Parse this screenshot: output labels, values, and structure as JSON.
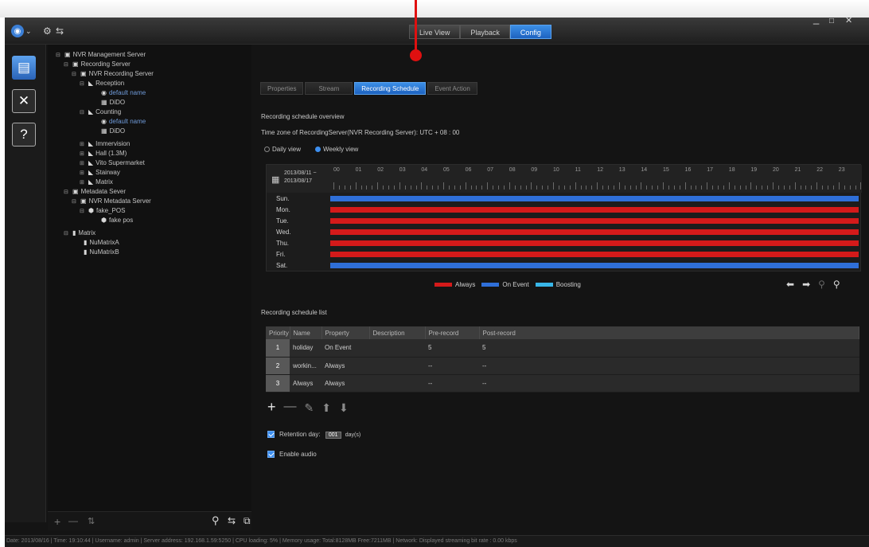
{
  "titlebar": {
    "nav_tabs": [
      {
        "label": "Live View",
        "active": false
      },
      {
        "label": "Playback",
        "active": false
      },
      {
        "label": "Config",
        "active": true
      }
    ],
    "window_controls": [
      "_",
      "□",
      "✕"
    ]
  },
  "tree": {
    "nodes": [
      {
        "label": "NVR Management Server",
        "toggle": "⊟",
        "icon": "server-icon"
      },
      {
        "label": "Recording Server",
        "toggle": "⊟",
        "icon": "server-icon"
      },
      {
        "label": "NVR Recording Server",
        "toggle": "⊟",
        "icon": "server-icon"
      },
      {
        "label": "Reception",
        "toggle": "⊟",
        "icon": "camera-group-icon"
      },
      {
        "label": "default name",
        "toggle": "",
        "icon": "camera-icon"
      },
      {
        "label": "DiDO",
        "toggle": "",
        "icon": "dido-icon"
      },
      {
        "label": "Counting",
        "toggle": "⊟",
        "icon": "camera-group-icon"
      },
      {
        "label": "default name",
        "toggle": "",
        "icon": "camera-icon"
      },
      {
        "label": "DiDO",
        "toggle": "",
        "icon": "dido-icon"
      },
      {
        "label": "Immervision",
        "toggle": "⊞",
        "icon": "camera-group-icon"
      },
      {
        "label": "Hall (1.3M)",
        "toggle": "⊞",
        "icon": "camera-group-icon"
      },
      {
        "label": "Vito Supermarket",
        "toggle": "⊞",
        "icon": "camera-group-icon"
      },
      {
        "label": "Stairway",
        "toggle": "⊞",
        "icon": "camera-group-icon"
      },
      {
        "label": "Matrix",
        "toggle": "⊞",
        "icon": "camera-group-icon"
      },
      {
        "label": "Metadata Sever",
        "toggle": "⊟",
        "icon": "server-icon"
      },
      {
        "label": "NVR Metadata Server",
        "toggle": "⊟",
        "icon": "server-icon"
      },
      {
        "label": "fake_POS",
        "toggle": "⊟",
        "icon": "pos-icon"
      },
      {
        "label": "fake pos",
        "toggle": "",
        "icon": "pos-icon"
      },
      {
        "label": "Matrix",
        "toggle": "⊟",
        "icon": "matrix-icon"
      },
      {
        "label": "NuMatrixA",
        "toggle": "",
        "icon": "matrix-icon"
      },
      {
        "label": "NuMatrixB",
        "toggle": "",
        "icon": "matrix-icon"
      }
    ],
    "bottom_tools": [
      "+",
      "—",
      "⇅"
    ]
  },
  "config": {
    "subtabs": [
      {
        "label": "Properties",
        "active": false
      },
      {
        "label": "Stream",
        "active": false
      },
      {
        "label": "Recording Schedule",
        "active": true
      },
      {
        "label": "Event Action",
        "active": false
      }
    ],
    "overview_title": "Recording schedule overview",
    "timezone_text": "Time zone of RecordingServer(NVR Recording Server): UTC + 08 : 00",
    "view_daily": "Daily view",
    "view_weekly": "Weekly view",
    "view_selected": "weekly",
    "date_range_start": "2013/08/11 ~",
    "date_range_end": "2013/08/17",
    "hours": [
      "00",
      "01",
      "02",
      "03",
      "04",
      "05",
      "06",
      "07",
      "08",
      "09",
      "10",
      "11",
      "12",
      "13",
      "14",
      "15",
      "16",
      "17",
      "18",
      "19",
      "20",
      "21",
      "22",
      "23"
    ],
    "days": [
      {
        "label": "Sun.",
        "mode": "On Event"
      },
      {
        "label": "Mon.",
        "mode": "Always"
      },
      {
        "label": "Tue.",
        "mode": "Always"
      },
      {
        "label": "Wed.",
        "mode": "Always"
      },
      {
        "label": "Thu.",
        "mode": "Always"
      },
      {
        "label": "Fri.",
        "mode": "Always"
      },
      {
        "label": "Sat.",
        "mode": "On Event"
      }
    ],
    "legend": [
      {
        "label": "Always",
        "color": "#d41a1a"
      },
      {
        "label": "On Event",
        "color": "#2f6fd8"
      },
      {
        "label": "Boosting",
        "color": "#38b6e8"
      }
    ],
    "list_title": "Recording schedule list",
    "list_columns": [
      "Priority",
      "Name",
      "Property",
      "Description",
      "Pre-record",
      "Post-record"
    ],
    "list_rows": [
      {
        "priority": "1",
        "name": "holiday",
        "property": "On Event",
        "description": "",
        "pre": "5",
        "post": "5"
      },
      {
        "priority": "2",
        "name": "workin...",
        "property": "Always",
        "description": "",
        "pre": "--",
        "post": "--"
      },
      {
        "priority": "3",
        "name": "Always",
        "property": "Always",
        "description": "",
        "pre": "--",
        "post": "--"
      }
    ],
    "retention_label": "Retention day:",
    "retention_value": "001",
    "retention_unit": "day(s)",
    "enable_audio_label": "Enable audio"
  },
  "status_text": "Date: 2013/08/16 | Time: 19:10:44 | Username: admin | Server address: 192.168.1.59:5250 | CPU loading: 5% | Memory usage: Total:8128MB Free:7211MB | Network: Displayed streaming bit rate : 0.00 kbps",
  "colors": {
    "always": "#d41a1a",
    "on_event": "#2f6fd8",
    "boosting": "#38b6e8",
    "accent": "#1d62c0"
  }
}
